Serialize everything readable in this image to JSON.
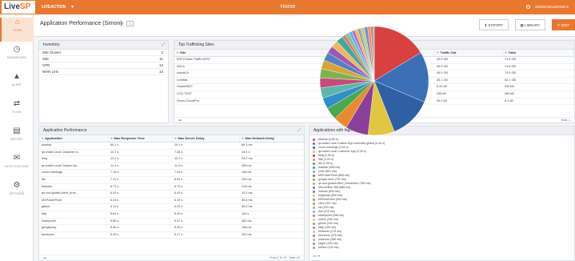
{
  "brand": {
    "live": "Live",
    "sp": "SP"
  },
  "topbar": {
    "context": "LIVEACTION",
    "title": "Home",
    "user": "SIMON BAUMANN"
  },
  "sidebar": [
    {
      "label": "HOME",
      "icon": "home-icon",
      "glyph": "⌂"
    },
    {
      "label": "DASHBOARD",
      "icon": "dashboard-icon",
      "glyph": "◷"
    },
    {
      "label": "ALERT",
      "icon": "alert-icon",
      "glyph": "▲"
    },
    {
      "label": "FLOW",
      "icon": "flow-icon",
      "glyph": "⇄"
    },
    {
      "label": "REPORT",
      "icon": "report-icon",
      "glyph": "▤"
    },
    {
      "label": "NOTIFICATIONS",
      "icon": "notifications-icon",
      "glyph": "✉"
    },
    {
      "label": "SETTINGS",
      "icon": "settings-icon",
      "glyph": "⚙"
    }
  ],
  "header": {
    "title": "Application Performance (Simon)",
    "tag": "2",
    "export": "EXPORT",
    "library": "LIBRARY",
    "edit": "EDIT"
  },
  "inventory": {
    "title": "Inventory",
    "items": [
      {
        "label": "Site Cluster",
        "value": "2"
      },
      {
        "label": "Site",
        "value": "11"
      },
      {
        "label": "CPE",
        "value": "12"
      },
      {
        "label": "WAN Link",
        "value": "13"
      }
    ]
  },
  "sites": {
    "title": "Top Trafficking Sites",
    "columns": [
      "Site",
      "Traffic In",
      "Traffic Out",
      "Total"
    ],
    "rows": [
      [
        "EDFH Bass Traffic ASST",
        "35.7 GB",
        "45.9 GB",
        "74.5 GB"
      ],
      [
        "NVLA",
        "35.6 GB",
        "45.9 GB",
        "74.5 GB"
      ],
      [
        "vojzroLA",
        "35.6 GB",
        "45.9 GB",
        "74.5 GB"
      ],
      [
        "LiveAfia",
        "35.6 GB",
        "25.1 GB",
        "60.1 GB"
      ],
      [
        "HuaweiSET",
        "494 kB",
        "6.31 kB",
        "530 kB"
      ],
      [
        "CCE-TEST",
        "25.5 kB",
        "338 kB",
        "364 kB"
      ],
      [
        "Demo-CircuitPro",
        "95.4 kB",
        "59.2 kB",
        "8.1 kB"
      ]
    ],
    "footer_right": "Total: 1"
  },
  "apps": {
    "title": "Application Performance",
    "columns": [
      "Application",
      "Max Response Time",
      "Max Server Delay",
      "Max Network Delay"
    ],
    "rows": [
      [
        "akamai",
        "59.1 s",
        "29.1 s",
        "69.3 ms"
      ],
      [
        "qe-tradd Local Customer A...",
        "14.7 s",
        "7.38 s",
        "14.4 s"
      ],
      [
        "bing",
        "12.4 s",
        "10.2 s",
        "23.2 ms"
      ],
      [
        "qe-tradd Local Custom Ap...",
        "11.9 s",
        "11.9 s",
        "255 ms"
      ],
      [
        "zoom-meetings",
        "7.15 s",
        "7.04 s",
        "108 ms"
      ],
      [
        "dfs",
        "7.11 s",
        "6.94 s",
        "244 ms"
      ],
      [
        "linkedin",
        "6.73 s",
        "6.72 s",
        "218 ms"
      ],
      [
        "qe-tool-global-client_bros...",
        "6.43 s",
        "6.43 s",
        "10.2 ms"
      ],
      [
        "MSPowerPoint",
        "6.23 s",
        "6.19 s",
        "59.8 ms"
      ],
      [
        "github",
        "6.11 s",
        "6.03 s",
        "55.0 ms"
      ],
      [
        "http",
        "5.64 s",
        "5.49 s",
        "124 s"
      ],
      [
        "sharepoint",
        "5.55 s",
        "5.37 s",
        "182 ms"
      ],
      [
        "googleplay",
        "5.46 s",
        "5.26 s",
        "198 ms"
      ],
      [
        "facebook",
        "5.29 s",
        "5.27 s",
        "202 ms"
      ]
    ],
    "footer": "From 1 To 15 · Total: 43"
  },
  "repartition": {
    "title": "Applications with highest delay / Repartition",
    "legend_footer": "1/3 ▼",
    "slices": [
      {
        "label": "akamai (4.69 s)",
        "value": 4.69,
        "color": "#d94040"
      },
      {
        "label": "qe-tradd Local Custom App overrides global (4.34 s)",
        "value": 4.34,
        "color": "#3b6fb6"
      },
      {
        "label": "zoom-meetings (3.63 s)",
        "value": 3.63,
        "color": "#2f5fa5"
      },
      {
        "label": "qe-tradd Local Customer App (2.26 s)",
        "value": 2.26,
        "color": "#e1c640"
      },
      {
        "label": "bing (1.95 s)",
        "value": 1.95,
        "color": "#8a3f9a"
      },
      {
        "label": "http (1.22 s)",
        "value": 1.22,
        "color": "#e98a2f"
      },
      {
        "label": "dfs (1.05 s)",
        "value": 1.05,
        "color": "#4aa84f"
      },
      {
        "label": "linkedin (955 ms)",
        "value": 0.955,
        "color": "#2f8fc9"
      },
      {
        "label": "zoho (891 ms)",
        "value": 0.891,
        "color": "#5bb8a8"
      },
      {
        "label": "MSPowerPoint (853 ms)",
        "value": 0.853,
        "color": "#c74b7a"
      },
      {
        "label": "google-docs (790 ms)",
        "value": 0.79,
        "color": "#7fb24a"
      },
      {
        "label": "qe-tool-global-client_linesection (760 ms)",
        "value": 0.76,
        "color": "#d6a43a"
      },
      {
        "label": "MicroOffice 365 (688 ms)",
        "value": 0.688,
        "color": "#4f82c4"
      },
      {
        "label": "outlook (634 ms)",
        "value": 0.634,
        "color": "#9b59b6"
      },
      {
        "label": "brightcab (599 ms)",
        "value": 0.599,
        "color": "#f0b85a"
      },
      {
        "label": "MSOneDrive (594 ms)",
        "value": 0.594,
        "color": "#3fa9a0"
      },
      {
        "label": "citrix (307 ms)",
        "value": 0.307,
        "color": "#e57373"
      },
      {
        "label": "ssl (303 ms)",
        "value": 0.303,
        "color": "#81c784"
      },
      {
        "label": "dns (315 ms)",
        "value": 0.315,
        "color": "#64b5f6"
      },
      {
        "label": "sharepoint (266 ms)",
        "value": 0.266,
        "color": "#ba68c8"
      },
      {
        "label": "oracle (255 ms)",
        "value": 0.255,
        "color": "#ffb74d"
      },
      {
        "label": "github (200 ms)",
        "value": 0.2,
        "color": "#4db6ac"
      },
      {
        "label": "ldap (109 ms)",
        "value": 0.109,
        "color": "#f06292"
      },
      {
        "label": "kerberos (278 ms)",
        "value": 0.278,
        "color": "#aed581"
      },
      {
        "label": "facebook (275 ms)",
        "value": 0.275,
        "color": "#7986cb"
      },
      {
        "label": "pinterest (266 ms)",
        "value": 0.266,
        "color": "#ff8a65"
      },
      {
        "label": "skype (200 ms)",
        "value": 0.2,
        "color": "#a1887f"
      },
      {
        "label": "webex (104 ms)",
        "value": 0.104,
        "color": "#90a4ae"
      }
    ]
  },
  "colors": {
    "accent": "#e9782f"
  }
}
